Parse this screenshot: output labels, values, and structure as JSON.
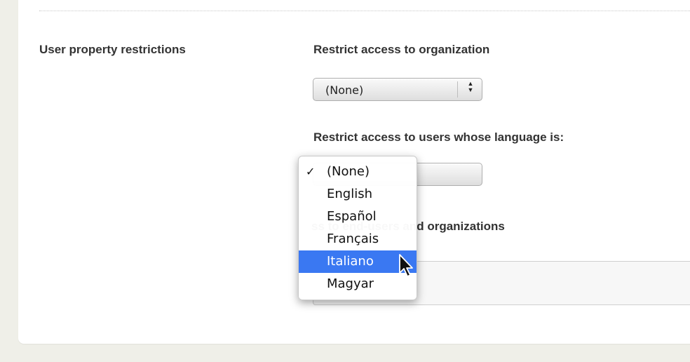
{
  "section": {
    "label": "User property restrictions"
  },
  "organization": {
    "label": "Restrict access to organization",
    "select_value": "(None)"
  },
  "language": {
    "label": "Restrict access to users whose language is:",
    "options": [
      "(None)",
      "English",
      "Español",
      "Français",
      "Italiano",
      "Magyar"
    ],
    "checked": "(None)",
    "highlighted": "Italiano"
  },
  "end_users": {
    "label_visible": "ss to end-users and organizations"
  },
  "icons": {
    "checkmark": "✓",
    "arrow_up": "▲",
    "arrow_down": "▼"
  },
  "colors": {
    "highlight": "#3a78f2"
  }
}
